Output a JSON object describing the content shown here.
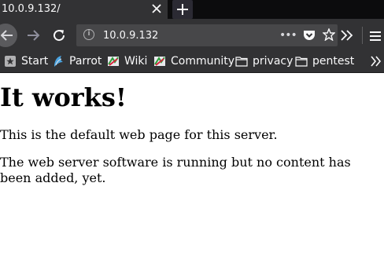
{
  "browser": {
    "tab": {
      "title": "10.0.9.132/"
    },
    "address": {
      "url": "10.0.9.132"
    },
    "bookmarks": [
      {
        "label": "Start",
        "icon": "start-icon"
      },
      {
        "label": "Parrot",
        "icon": "parrot-icon"
      },
      {
        "label": "Wiki",
        "icon": "wiki-icon"
      },
      {
        "label": "Community",
        "icon": "community-icon"
      },
      {
        "label": "privacy",
        "icon": "folder-icon"
      },
      {
        "label": "pentest",
        "icon": "folder-icon"
      }
    ],
    "colors": {
      "toolbar": "#323234",
      "tabstrip": "#0c0c0d",
      "urlbar": "#474749",
      "text": "#f9f9fa"
    }
  },
  "page": {
    "heading": "It works!",
    "paragraph1": "This is the default web page for this server.",
    "paragraph2": "The web server software is running but no content has been added, yet."
  }
}
